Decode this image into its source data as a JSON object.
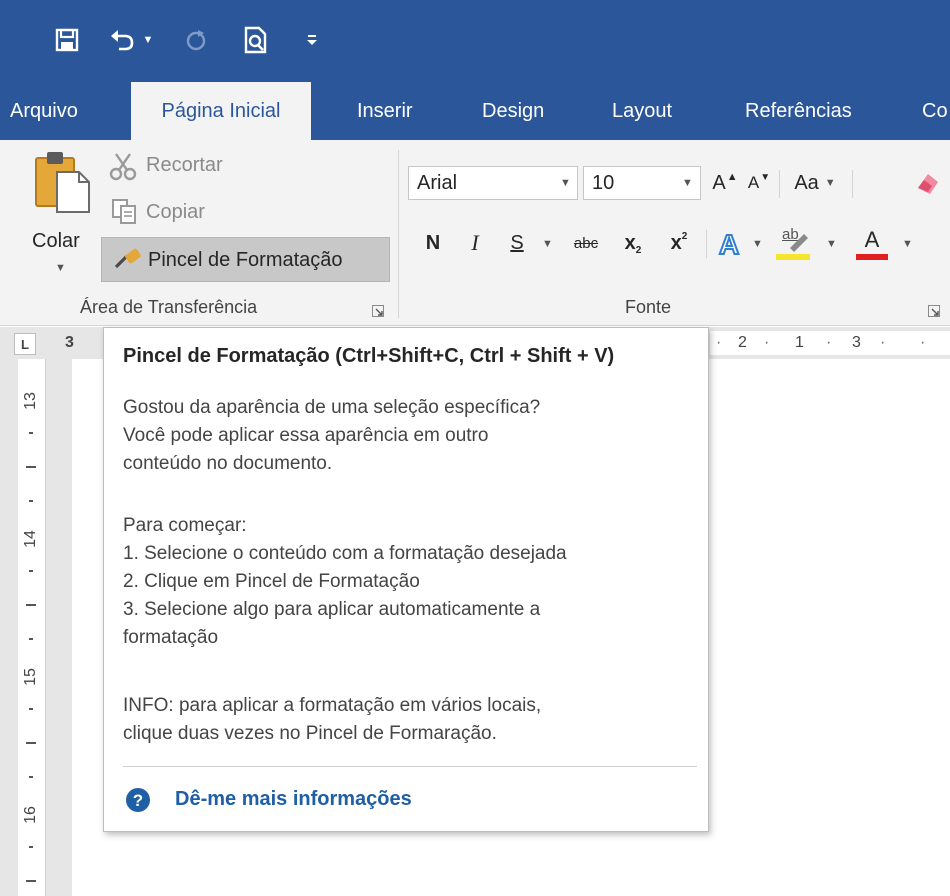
{
  "quick_access": {
    "save_icon": "save-icon",
    "undo_icon": "undo-icon",
    "redo_icon": "redo-icon",
    "print_preview_icon": "print-preview-icon",
    "customize_icon": "customize-qat-icon"
  },
  "tabs": [
    {
      "label": "Arquivo",
      "active": false
    },
    {
      "label": "Página Inicial",
      "active": true
    },
    {
      "label": "Inserir",
      "active": false
    },
    {
      "label": "Design",
      "active": false
    },
    {
      "label": "Layout",
      "active": false
    },
    {
      "label": "Referências",
      "active": false
    },
    {
      "label": "Co",
      "active": false
    }
  ],
  "clipboard": {
    "paste_label": "Colar",
    "cut_label": "Recortar",
    "copy_label": "Copiar",
    "format_painter_label": "Pincel de Formatação",
    "group_label": "Área de Transferência"
  },
  "font": {
    "font_name": "Arial",
    "font_size": "10",
    "grow_label": "A",
    "shrink_label": "A",
    "case_label": "Aa",
    "bold_label": "N",
    "italic_label": "I",
    "underline_label": "S",
    "strike_label": "abc",
    "subscript_label": "x",
    "superscript_label": "x",
    "highlight_label": "ab",
    "font_color_label": "A",
    "group_label": "Fonte"
  },
  "ruler": {
    "top_marks": [
      "L",
      "3",
      "2",
      "1",
      "3"
    ],
    "left_numbers": [
      "13",
      "14",
      "15",
      "16"
    ]
  },
  "tooltip": {
    "title": "Pincel de Formatação (Ctrl+Shift+C, Ctrl + Shift + V)",
    "paragraph1": [
      "Gostou da aparência de uma seleção específica?",
      "Você pode aplicar essa aparência em outro",
      "conteúdo no documento."
    ],
    "steps_heading": "Para começar:",
    "steps": [
      "1. Selecione o conteúdo com a formatação desejada",
      "2. Clique em Pincel de Formatação",
      "3. Selecione algo para aplicar automaticamente a",
      "formatação"
    ],
    "info": [
      "INFO: para aplicar a formatação em vários locais,",
      "clique duas vezes no Pincel de Formaração."
    ],
    "link_label": "Dê-me mais informações"
  },
  "colors": {
    "title_bar": "#2b579a",
    "ribbon_bg": "#f3f3f3",
    "highlight_yellow": "#f5e52f",
    "font_red": "#e02020",
    "link_blue": "#1f5fa6"
  }
}
